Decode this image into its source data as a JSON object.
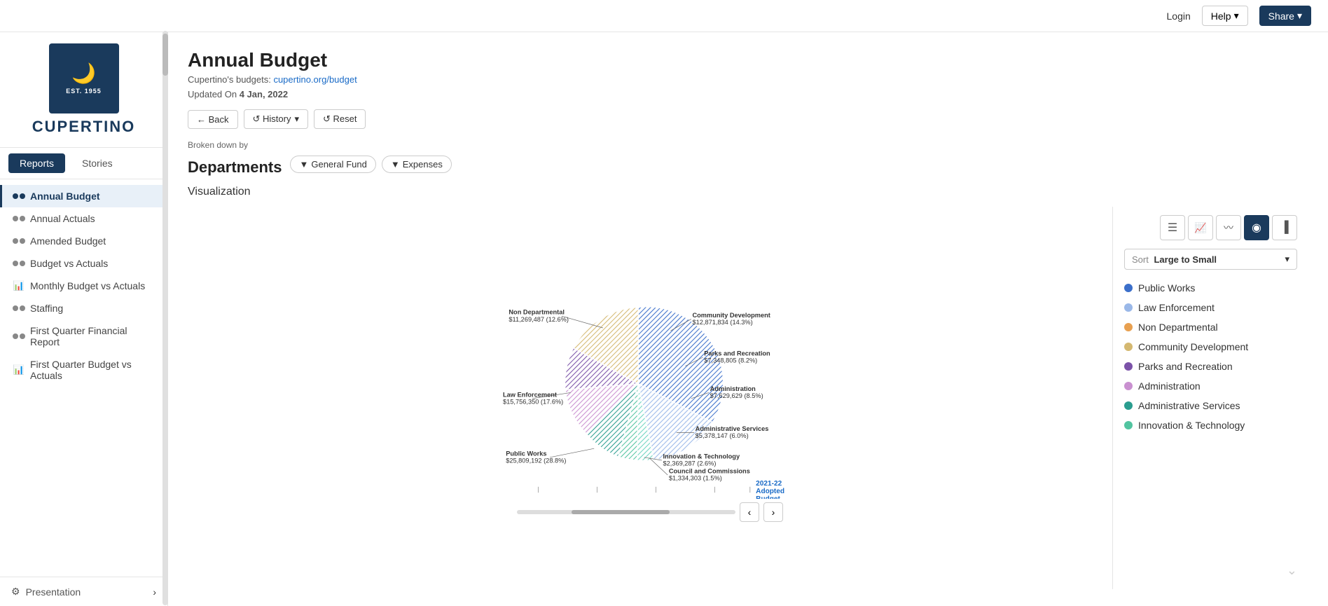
{
  "topbar": {
    "login": "Login",
    "help": "Help",
    "share": "Share",
    "help_arrow": "▾",
    "share_arrow": "▾"
  },
  "sidebar": {
    "logo_est": "EST. 1955",
    "logo_city": "CUPERTINO",
    "tabs": [
      {
        "id": "reports",
        "label": "Reports",
        "active": true
      },
      {
        "id": "stories",
        "label": "Stories",
        "active": false
      }
    ],
    "items": [
      {
        "id": "annual-budget",
        "label": "Annual Budget",
        "icon": "two-dots",
        "active": true
      },
      {
        "id": "annual-actuals",
        "label": "Annual Actuals",
        "icon": "two-dots",
        "active": false
      },
      {
        "id": "amended-budget",
        "label": "Amended Budget",
        "icon": "two-dots",
        "active": false
      },
      {
        "id": "budget-vs-actuals",
        "label": "Budget vs Actuals",
        "icon": "two-dots",
        "active": false
      },
      {
        "id": "monthly-budget-vs-actuals",
        "label": "Monthly Budget vs Actuals",
        "icon": "chart",
        "active": false
      },
      {
        "id": "staffing",
        "label": "Staffing",
        "icon": "two-dots",
        "active": false
      },
      {
        "id": "first-quarter-financial",
        "label": "First Quarter Financial Report",
        "icon": "two-dots",
        "active": false
      },
      {
        "id": "first-quarter-budget",
        "label": "First Quarter Budget vs Actuals",
        "icon": "chart",
        "active": false
      }
    ],
    "presentation": "Presentation"
  },
  "page": {
    "title": "Annual Budget",
    "subtitle_prefix": "Cupertino's budgets: ",
    "subtitle_link": "cupertino.org/budget",
    "updated_prefix": "Updated On ",
    "updated_date": "4 Jan, 2022",
    "broken_down_label": "Broken down by",
    "broken_down_title": "Departments",
    "filters": [
      {
        "id": "general-fund",
        "label": "General Fund"
      },
      {
        "id": "expenses",
        "label": "Expenses"
      }
    ],
    "viz_label": "Visualization",
    "toolbar": {
      "back": "← Back",
      "history": "↺ History",
      "history_arrow": "▾",
      "reset": "↺ Reset"
    }
  },
  "chart": {
    "segments": [
      {
        "id": "public-works",
        "label": "Public Works",
        "value": "$25,809,192 (28.8%)",
        "color": "#3b6fca",
        "percent": 28.8,
        "hatch": true
      },
      {
        "id": "law-enforcement",
        "label": "Law Enforcement",
        "value": "$15,756,350 (17.6%)",
        "color": "#9ab8e8",
        "percent": 17.6,
        "hatch": true
      },
      {
        "id": "non-departmental",
        "label": "Non Departmental",
        "value": "$11,269,487 (12.6%)",
        "color": "#e8a050",
        "percent": 12.6,
        "hatch": true
      },
      {
        "id": "community-development",
        "label": "Community Development",
        "value": "$12,871,834 (14.3%)",
        "color": "#d4b870",
        "percent": 14.3,
        "hatch": true
      },
      {
        "id": "parks-recreation",
        "label": "Parks and Recreation",
        "value": "$7,348,805 (8.2%)",
        "color": "#7b52a8",
        "percent": 8.2,
        "hatch": true
      },
      {
        "id": "administration",
        "label": "Administration",
        "value": "$7,629,629 (8.5%)",
        "color": "#c990d0",
        "percent": 8.5,
        "hatch": true
      },
      {
        "id": "admin-services",
        "label": "Administrative Services",
        "value": "$5,378,147 (6.0%)",
        "color": "#2a9d8f",
        "percent": 6.0,
        "hatch": true
      },
      {
        "id": "innovation-tech",
        "label": "Innovation & Technology",
        "value": "$2,369,287 (2.6%)",
        "color": "#52c4a0",
        "percent": 2.6,
        "hatch": true
      },
      {
        "id": "council-commissions",
        "label": "Council and Commissions",
        "value": "$1,334,303 (1.5%)",
        "color": "#6dd4c0",
        "percent": 1.5,
        "hatch": true
      }
    ]
  },
  "right_panel": {
    "chart_types": [
      {
        "id": "table",
        "icon": "≡",
        "active": false
      },
      {
        "id": "line",
        "icon": "📈",
        "active": false
      },
      {
        "id": "trend",
        "icon": "〰",
        "active": false
      },
      {
        "id": "pie",
        "icon": "◉",
        "active": true
      },
      {
        "id": "bar",
        "icon": "▐",
        "active": false
      }
    ],
    "sort_label": "Sort",
    "sort_value": "Large to Small",
    "sort_arrow": "▾"
  },
  "timeline": {
    "label_line1": "2021-22",
    "label_line2": "Adopted",
    "label_line3": "Budget"
  },
  "legend": {
    "items": [
      {
        "id": "public-works",
        "label": "Public Works",
        "color": "#3b6fca"
      },
      {
        "id": "law-enforcement",
        "label": "Law Enforcement",
        "color": "#9ab8e8"
      },
      {
        "id": "non-departmental",
        "label": "Non Departmental",
        "color": "#e8a050"
      },
      {
        "id": "community-development",
        "label": "Community Development",
        "color": "#d4b870"
      },
      {
        "id": "parks-recreation",
        "label": "Parks and Recreation",
        "color": "#7b52a8"
      },
      {
        "id": "administration",
        "label": "Administration",
        "color": "#c990d0"
      },
      {
        "id": "admin-services",
        "label": "Administrative Services",
        "color": "#2a9d8f"
      },
      {
        "id": "innovation-tech",
        "label": "Innovation & Technology",
        "color": "#52c4a0"
      }
    ]
  }
}
